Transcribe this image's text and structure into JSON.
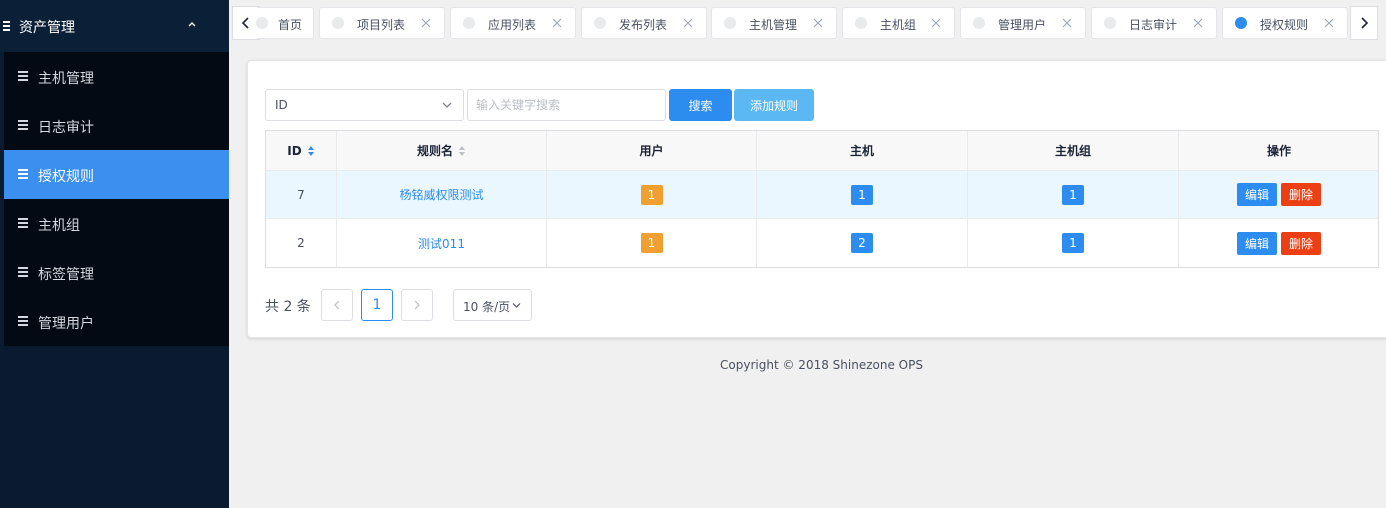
{
  "sidebar": {
    "group_title": "资产管理",
    "items": [
      {
        "label": "主机管理",
        "active": false
      },
      {
        "label": "日志审计",
        "active": false
      },
      {
        "label": "授权规则",
        "active": true
      },
      {
        "label": "主机组",
        "active": false
      },
      {
        "label": "标签管理",
        "active": false
      },
      {
        "label": "管理用户",
        "active": false
      }
    ]
  },
  "tabs": [
    {
      "label": "首页",
      "closable": false,
      "active": false
    },
    {
      "label": "项目列表",
      "closable": true,
      "active": false
    },
    {
      "label": "应用列表",
      "closable": true,
      "active": false
    },
    {
      "label": "发布列表",
      "closable": true,
      "active": false
    },
    {
      "label": "主机管理",
      "closable": true,
      "active": false
    },
    {
      "label": "主机组",
      "closable": true,
      "active": false
    },
    {
      "label": "管理用户",
      "closable": true,
      "active": false
    },
    {
      "label": "日志审计",
      "closable": true,
      "active": false
    },
    {
      "label": "授权规则",
      "closable": true,
      "active": true
    }
  ],
  "toolbar": {
    "select_value": "ID",
    "search_placeholder": "输入关键字搜索",
    "search_label": "搜索",
    "add_label": "添加规则"
  },
  "table": {
    "columns": [
      "ID",
      "规则名",
      "用户",
      "主机",
      "主机组",
      "操作"
    ],
    "rows": [
      {
        "id": "7",
        "name": "杨铭威权限测试",
        "users": "1",
        "hosts": "1",
        "groups": "1"
      },
      {
        "id": "2",
        "name": "测试011",
        "users": "1",
        "hosts": "2",
        "groups": "1"
      }
    ],
    "edit_label": "编辑",
    "delete_label": "删除"
  },
  "pagination": {
    "total_text": "共 2 条",
    "current_page": "1",
    "page_size": "10 条/页"
  },
  "footer": {
    "copyright": "Copyright © 2018 Shinezone OPS"
  },
  "colors": {
    "sidebar_bg": "#0a1a2f",
    "sidebar_active": "#3b8fee",
    "primary": "#2d8cf0",
    "light_primary": "#5cb8f2",
    "danger": "#ed3f14",
    "warning": "#f0a030"
  }
}
